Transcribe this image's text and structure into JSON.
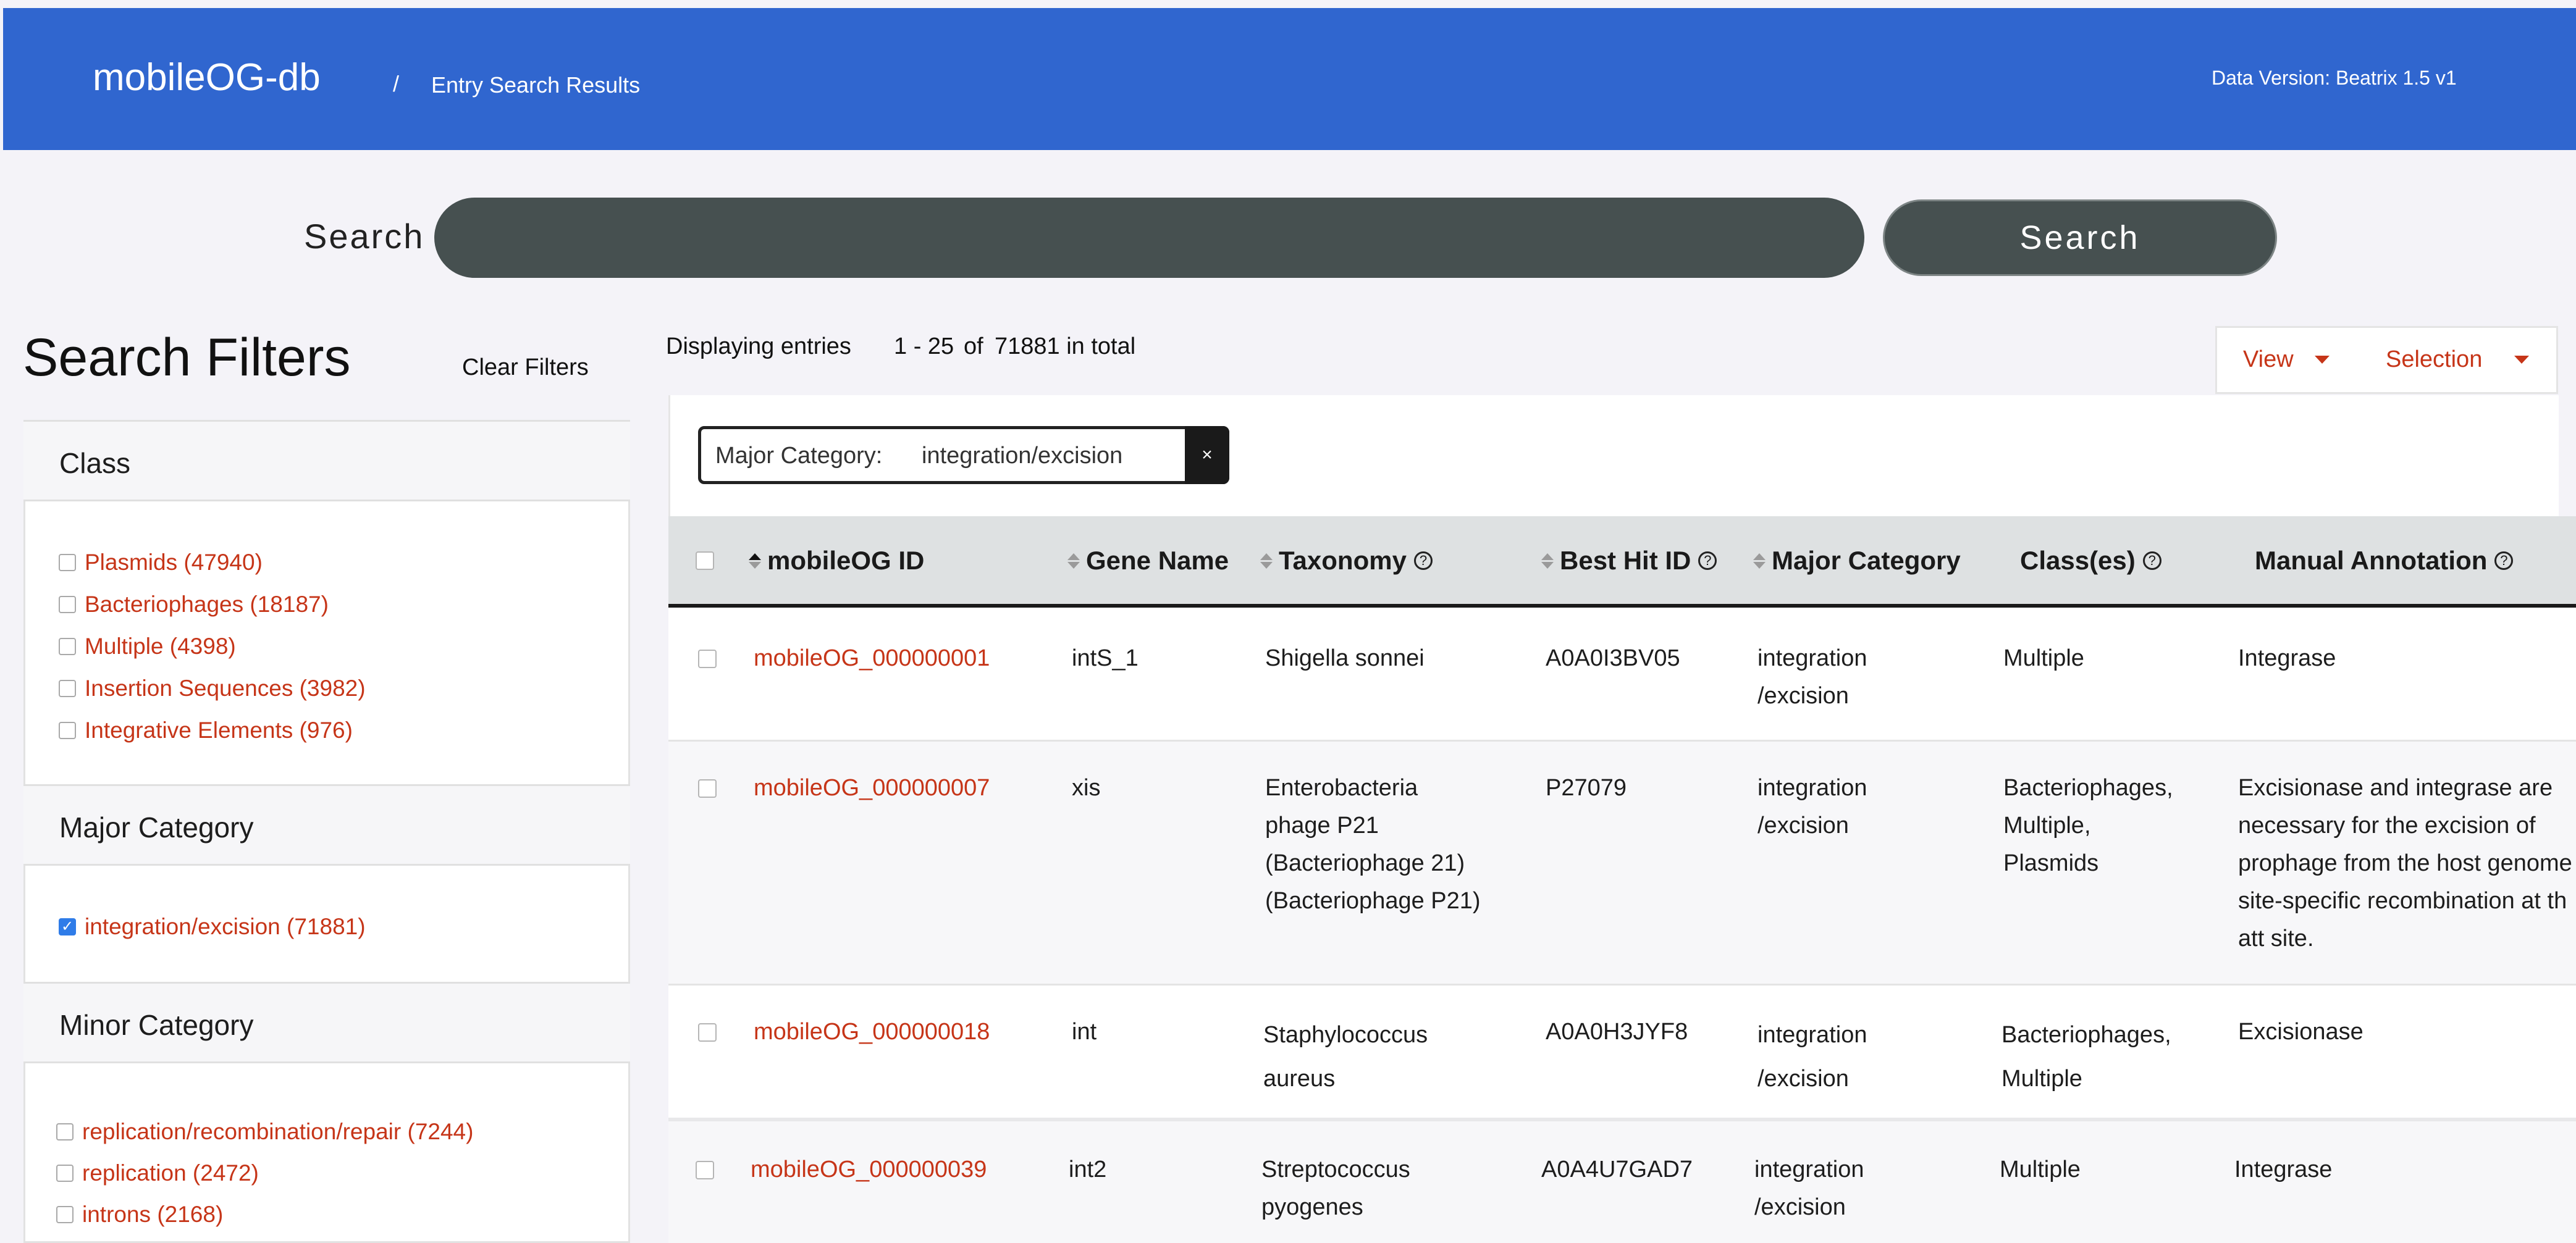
{
  "header": {
    "app_title": "mobileOG-db",
    "breadcrumb_sep": "/",
    "breadcrumb_current": "Entry Search Results",
    "data_version": "Data Version: Beatrix 1.5 v1"
  },
  "search": {
    "label": "Search",
    "placeholder": "",
    "button_label": "Search"
  },
  "filters": {
    "title": "Search Filters",
    "clear_label": "Clear Filters",
    "class": {
      "heading": "Class",
      "items": [
        {
          "label": "Plasmids (47940)",
          "checked": false
        },
        {
          "label": "Bacteriophages (18187)",
          "checked": false
        },
        {
          "label": "Multiple (4398)",
          "checked": false
        },
        {
          "label": "Insertion Sequences (3982)",
          "checked": false
        },
        {
          "label": "Integrative Elements (976)",
          "checked": false
        }
      ]
    },
    "major": {
      "heading": "Major Category",
      "items": [
        {
          "label": "integration/excision (71881)",
          "checked": true
        }
      ]
    },
    "minor": {
      "heading": "Minor Category",
      "items": [
        {
          "label": "replication/recombination/repair (7244)",
          "checked": false
        },
        {
          "label": "replication (2472)",
          "checked": false
        },
        {
          "label": "introns (2168)",
          "checked": false
        }
      ]
    }
  },
  "results": {
    "displaying_label": "Displaying entries",
    "range": "1 - 25",
    "of_label": "of",
    "total": "71881 in total",
    "view_label": "View",
    "selection_label": "Selection",
    "chip_label": "Major Category:",
    "chip_value": "integration/excision",
    "chip_close": "×"
  },
  "table": {
    "columns": {
      "id": "mobileOG ID",
      "gene": "Gene Name",
      "taxonomy": "Taxonomy",
      "besthit": "Best Hit ID",
      "major": "Major Category",
      "classes": "Class(es)",
      "annotation": "Manual Annotation"
    },
    "help_glyph": "?",
    "rows": [
      {
        "id": "mobileOG_000000001",
        "gene": "intS_1",
        "taxonomy": "Shigella sonnei",
        "besthit": "A0A0I3BV05",
        "major": "integration\n/excision",
        "classes": "Multiple",
        "annotation": "Integrase"
      },
      {
        "id": "mobileOG_000000007",
        "gene": "xis",
        "taxonomy": "Enterobacteria\nphage P21\n(Bacteriophage 21)\n(Bacteriophage P21)",
        "besthit": "P27079",
        "major": "integration\n/excision",
        "classes": "Bacteriophages,\nMultiple,\nPlasmids",
        "annotation": "Excisionase and integrase are\nnecessary for the excision of\nprophage from the host genome\nsite-specific recombination at th\natt site."
      },
      {
        "id": "mobileOG_000000018",
        "gene": "int",
        "taxonomy": "Staphylococcus\naureus",
        "besthit": "A0A0H3JYF8",
        "major": "integration\n/excision",
        "classes": "Bacteriophages,\nMultiple",
        "annotation": "Excisionase"
      },
      {
        "id": "mobileOG_000000039",
        "gene": "int2",
        "taxonomy": "Streptococcus\npyogenes",
        "besthit": "A0A4U7GAD7",
        "major": "integration\n/excision",
        "classes": "Multiple",
        "annotation": "Integrase"
      }
    ]
  }
}
